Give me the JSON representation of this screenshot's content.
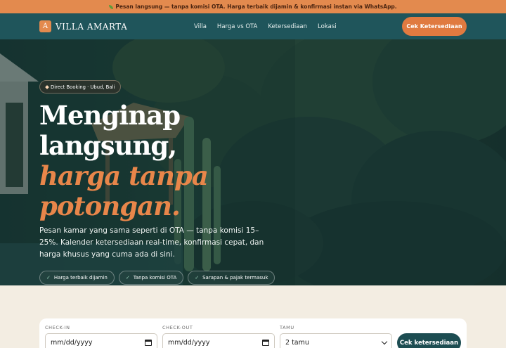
{
  "topbar": {
    "text": "Pesan langsung — tanpa komisi OTA. Harga terbaik dijamin & konfirmasi instan via WhatsApp."
  },
  "nav": {
    "logo_letter": "A",
    "brand": "VILLA AMARTA",
    "links": [
      "Villa",
      "Harga vs OTA",
      "Ketersediaan",
      "Lokasi"
    ],
    "cta": "Cek Ketersediaan"
  },
  "hero": {
    "badge": "Direct Booking · Ubud, Bali",
    "headline_line1": "Menginap",
    "headline_line2": "langsung,",
    "headline_accent1": "harga tanpa",
    "headline_accent2": "potongan.",
    "lead": "Pesan kamar yang sama seperti di OTA — tanpa komisi 15–25%. Kalender ketersediaan real-time, konfirmasi cepat, dan harga khusus yang cuma ada di sini.",
    "chips": [
      "Harga terbaik dijamin",
      "Tanpa komisi OTA",
      "Sarapan & pajak termasuk"
    ]
  },
  "booking": {
    "checkin_label": "CHECK-IN",
    "checkin_value": "mm/dd/yyyy",
    "checkout_label": "CHECK-OUT",
    "checkout_value": "mm/dd/yyyy",
    "guests_label": "TAMU",
    "guests_value": "2 tamu",
    "submit": "Cek ketersediaan"
  },
  "colors": {
    "accent": "#e07a40",
    "teal": "#1f555b",
    "cream": "#f3ede2"
  }
}
